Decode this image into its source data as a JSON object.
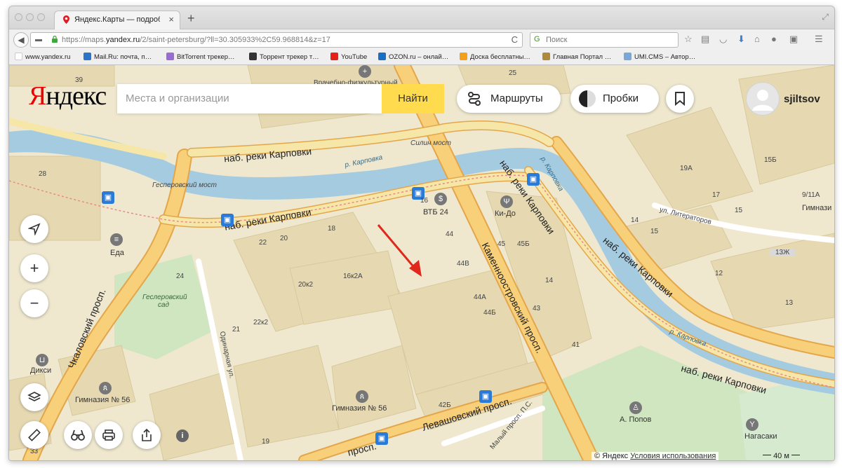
{
  "browser": {
    "tab_title": "Яндекс.Карты — подроб…",
    "close_glyph": "×",
    "new_tab_glyph": "+",
    "url_prefix": "https://maps.",
    "url_domain": "yandex.ru",
    "url_path": "/2/saint-petersburg/?ll=30.305933%2C59.968814&z=17",
    "search_placeholder": "Поиск",
    "search_engine_glyph": "G",
    "back_glyph": "◀",
    "reload_glyph": "C",
    "toolbar_icons": [
      "star-icon",
      "reading-list-icon",
      "pocket-icon",
      "download-icon",
      "home-icon",
      "chat-icon",
      "shield-icon",
      "menu-icon"
    ]
  },
  "bookmarks": [
    {
      "label": "www.yandex.ru",
      "color": "#ffffff"
    },
    {
      "label": "Mail.Ru: почта, п…",
      "color": "#2b74c9"
    },
    {
      "label": "BitTorrent трекер…",
      "color": "#9a6bd2"
    },
    {
      "label": "Торрент трекер т…",
      "color": "#333333"
    },
    {
      "label": "YouTube",
      "color": "#e62117"
    },
    {
      "label": "OZON.ru – онлай…",
      "color": "#1a6fc4"
    },
    {
      "label": "Доска бесплатны…",
      "color": "#f2a01a"
    },
    {
      "label": "Главная Портал …",
      "color": "#b08a3c"
    },
    {
      "label": "UMI.CMS – Автор…",
      "color": "#7aa6d8"
    }
  ],
  "header": {
    "logo_first": "Я",
    "logo_rest": "ндекс",
    "search_placeholder": "Места и организации",
    "find_button": "Найти",
    "routes_label": "Маршруты",
    "traffic_label": "Пробки",
    "username": "sjiltsov"
  },
  "controls": {
    "info": "i"
  },
  "map": {
    "streets": {
      "karpovki_top": "наб. реки Карповки",
      "karpovki_mid": "наб. реки Карповки",
      "karpovki_right1": "наб. реки Карповки",
      "karpovki_right2": "наб. реки Карповки",
      "karpovki_bottom": "наб. реки Карповки",
      "kamennoostrovsky": "Каменноостровский просп.",
      "chkalovsky": "Чкаловский просп.",
      "levashovsky": "Левашовский просп.",
      "odinarnaya": "Одинарная ул.",
      "literatorov": "ул. Литераторов",
      "maly_prosp": "Малый просп. П.С.",
      "prosp_bottom": "просп."
    },
    "water": {
      "karpovka1": "р. Карповка",
      "karpovka2": "р. Карповка",
      "karpovka3": "р. Карповка"
    },
    "bridges": {
      "gesler": "Гесперовский мост",
      "silin": "Силин мост"
    },
    "park": "Геслеровский сад",
    "places": {
      "eda": "Еда",
      "vtb": "ВТБ 24",
      "kido": "Ки-До",
      "diksi": "Дикси",
      "gym56a": "Гимназия № 56",
      "gym56b": "Гимназия № 56",
      "popov": "А. Попов",
      "nagasaki": "Нагасаки",
      "gymn_right": "Гимнази",
      "vrach": "Врачебно-физкультурный"
    },
    "numbers": {
      "n39": "39",
      "n25": "25",
      "n28": "28",
      "n22": "22",
      "n20": "20",
      "n18": "18",
      "n16": "16",
      "n44": "44",
      "n44v": "44В",
      "n44a": "44А",
      "n44b": "44Б",
      "n45": "45",
      "n45b": "45Б",
      "n14a": "14",
      "n43": "43",
      "n41": "41",
      "n20k2": "20к2",
      "n16k2a": "16к2А",
      "n22k2": "22к2",
      "n21": "21",
      "n24": "24",
      "n19": "19",
      "n42b": "42Б",
      "n33": "33",
      "n19a": "19А",
      "n17": "17",
      "n15b": "15Б",
      "n15": "15",
      "n9_11a": "9/11А",
      "n14": "14",
      "n15c": "15",
      "n13zh": "13Ж",
      "n12": "12",
      "n13": "13"
    }
  },
  "footer": {
    "copyright": "© Яндекс",
    "terms": "Условия использования",
    "scale": "40 м"
  },
  "colors": {
    "accent": "#ffdb4d",
    "river": "#a5cbe0",
    "road_major": "#f8d07a",
    "road_border": "#e3a64a",
    "park": "#cfe6c0",
    "building": "#e4d6b0",
    "land": "#efe8cf",
    "arrow": "#e0281c",
    "transport": "#2a7ad8"
  }
}
